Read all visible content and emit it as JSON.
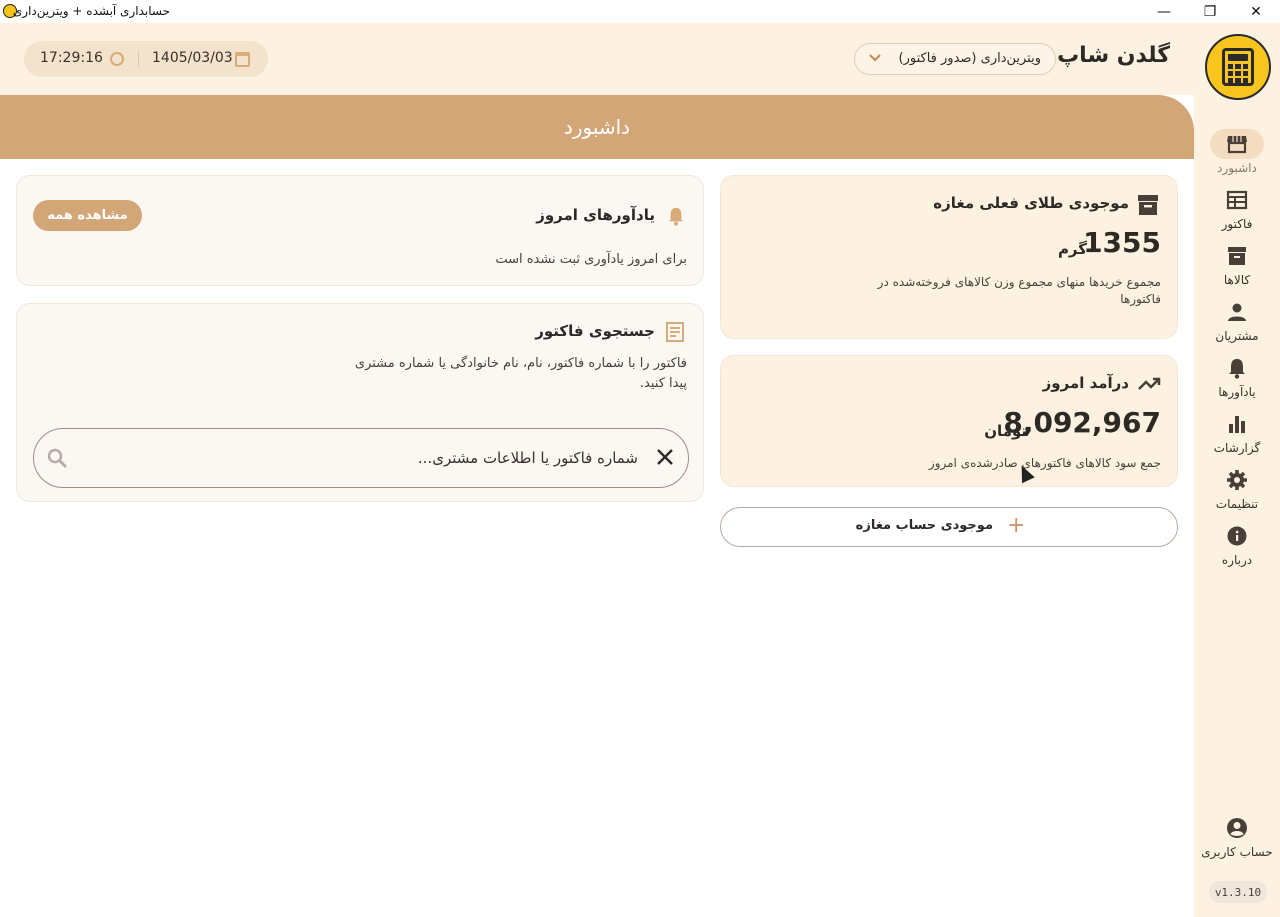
{
  "window": {
    "title": "حسابداری آبشده + ویترین‌داری",
    "minimize": "—",
    "restore": "❐",
    "close": "✕"
  },
  "header": {
    "shop_name": "گلدن شاپ",
    "mode_select": "ویترین‌داری (صدور فاکتور)",
    "date": "1405/03/03",
    "time": "17:29:16"
  },
  "sidebar": {
    "items": [
      {
        "label": "داشبورد",
        "icon": "store-icon"
      },
      {
        "label": "فاکتور",
        "icon": "invoice-icon"
      },
      {
        "label": "کالاها",
        "icon": "archive-icon"
      },
      {
        "label": "مشتریان",
        "icon": "person-icon"
      },
      {
        "label": "یادآورها",
        "icon": "bell-icon"
      },
      {
        "label": "گزارشات",
        "icon": "bar-chart-icon"
      },
      {
        "label": "تنظیمات",
        "icon": "gear-icon"
      },
      {
        "label": "درباره",
        "icon": "info-icon"
      }
    ],
    "account_label": "حساب کاربری",
    "version": "v1.3.10"
  },
  "page": {
    "title": "داشبورد"
  },
  "gold_stock": {
    "title": "موجودی طلای فعلی مغازه",
    "value": "1355",
    "unit": "گرم",
    "description": "مجموع خریدها منهای مجموع وزن کالاهای فروخته‌شده در فاکتورها"
  },
  "today_income": {
    "title": "درآمد امروز",
    "value": "8,092,967",
    "unit": "تومان",
    "description": "جمع سود کالاهای فاکتورهای صادرشده‌ی امروز"
  },
  "add_balance_button": "موجودی حساب مغازه",
  "reminders": {
    "title": "یادآورهای امروز",
    "view_all": "مشاهده همه",
    "empty_text": "برای امروز یادآوری ثبت نشده است"
  },
  "invoice_search": {
    "title": "جستجوی فاکتور",
    "description": "فاکتور را با شماره فاکتور، نام، نام خانوادگی یا شماره مشتری پیدا کنید.",
    "placeholder": "شماره فاکتور یا اطلاعات مشتری..."
  }
}
